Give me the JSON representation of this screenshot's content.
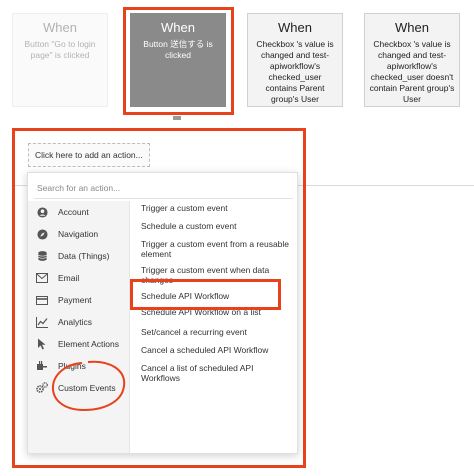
{
  "events": [
    {
      "title": "When",
      "desc": "Button \"Go to login page\" is clicked"
    },
    {
      "title": "When",
      "desc": "Button 送信する is clicked"
    },
    {
      "title": "When",
      "desc": "Checkbox 's value is changed and test-apiworkflow's checked_user contains Parent group's User"
    },
    {
      "title": "When",
      "desc": "Checkbox 's value is changed and test-apiworkflow's checked_user doesn't contain Parent group's User"
    }
  ],
  "add_action_label": "Click here to add an action...",
  "search_placeholder": "Search for an action...",
  "categories": [
    {
      "label": "Account",
      "icon": "person-icon"
    },
    {
      "label": "Navigation",
      "icon": "compass-icon"
    },
    {
      "label": "Data (Things)",
      "icon": "database-icon"
    },
    {
      "label": "Email",
      "icon": "envelope-icon"
    },
    {
      "label": "Payment",
      "icon": "credit-card-icon"
    },
    {
      "label": "Analytics",
      "icon": "chart-icon"
    },
    {
      "label": "Element Actions",
      "icon": "pointer-icon"
    },
    {
      "label": "Plugins",
      "icon": "plug-icon"
    },
    {
      "label": "Custom Events",
      "icon": "gears-icon"
    }
  ],
  "actions": [
    "Trigger a custom event",
    "Schedule a custom event",
    "Trigger a custom event from a reusable element",
    "Trigger a custom event when data changes",
    "Schedule API Workflow",
    "Schedule API Workflow on a list",
    "Set/cancel a recurring event",
    "Cancel a scheduled API Workflow",
    "Cancel a list of scheduled API Workflows"
  ],
  "colors": {
    "highlight": "#e8421d",
    "selected_card": "#8a8a8a"
  }
}
